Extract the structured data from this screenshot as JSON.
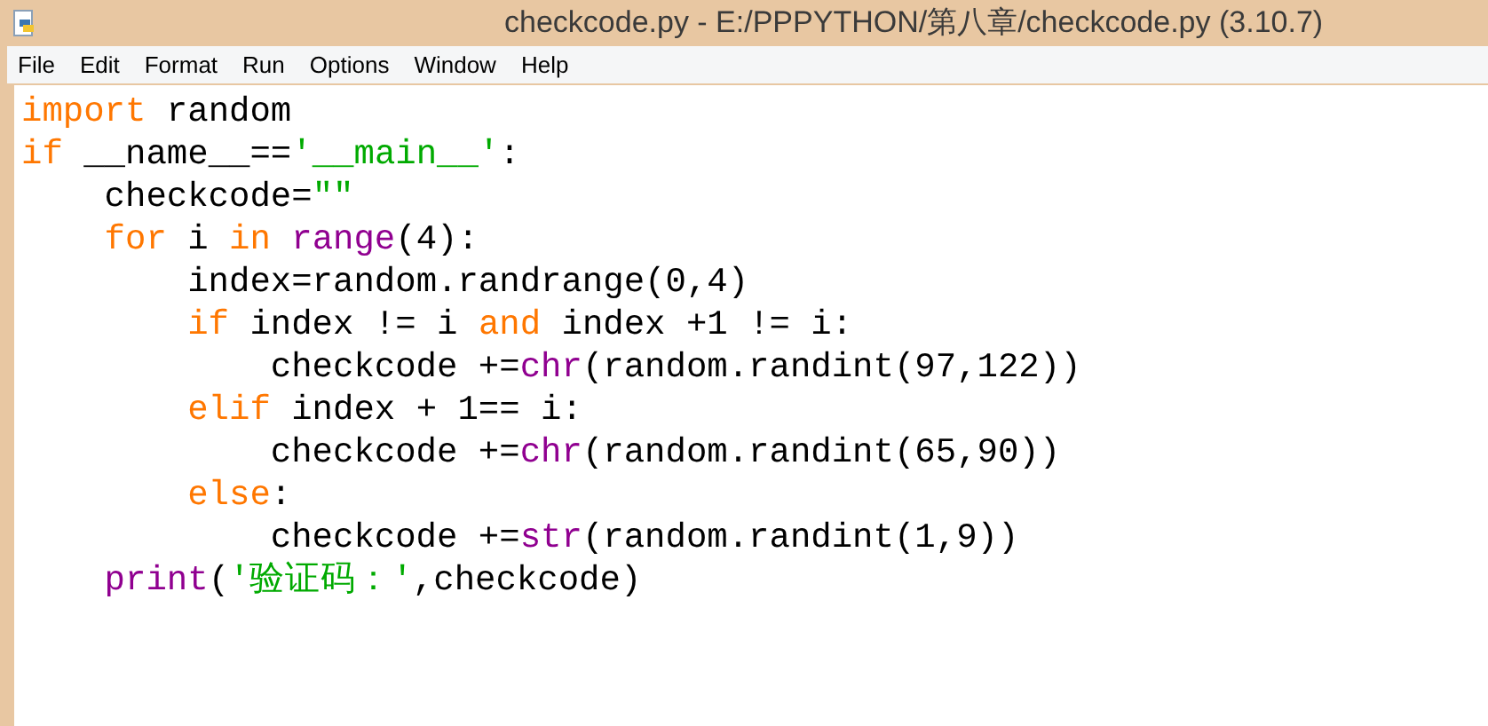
{
  "window": {
    "title": "checkcode.py - E:/PPPYTHON/第八章/checkcode.py (3.10.7)"
  },
  "menu": [
    "File",
    "Edit",
    "Format",
    "Run",
    "Options",
    "Window",
    "Help"
  ],
  "code_lines": [
    {
      "tokens": [
        {
          "kind": "keyword",
          "text": "import"
        },
        {
          "kind": "plain",
          "text": " random"
        }
      ]
    },
    {
      "tokens": [
        {
          "kind": "keyword",
          "text": "if"
        },
        {
          "kind": "plain",
          "text": " __name__=="
        },
        {
          "kind": "string",
          "text": "'__main__'"
        },
        {
          "kind": "plain",
          "text": ":"
        }
      ],
      "children": [
        {
          "tokens": [
            {
              "kind": "plain",
              "text": "checkcode="
            },
            {
              "kind": "string",
              "text": "\"\""
            }
          ]
        },
        {
          "tokens": [
            {
              "kind": "keyword",
              "text": "for"
            },
            {
              "kind": "plain",
              "text": " i "
            },
            {
              "kind": "keyword",
              "text": "in"
            },
            {
              "kind": "builtin",
              "text": " range"
            },
            {
              "kind": "plain",
              "text": "(4):"
            }
          ],
          "children": [
            {
              "tokens": [
                {
                  "kind": "plain",
                  "text": "index=random.randrange(0,4)"
                }
              ]
            },
            {
              "tokens": [
                {
                  "kind": "keyword",
                  "text": "if"
                },
                {
                  "kind": "plain",
                  "text": " index != i "
                },
                {
                  "kind": "keyword",
                  "text": "and"
                },
                {
                  "kind": "plain",
                  "text": " index +1 != i:"
                }
              ],
              "children": [
                {
                  "tokens": [
                    {
                      "kind": "plain",
                      "text": "checkcode +="
                    },
                    {
                      "kind": "builtin",
                      "text": "chr"
                    },
                    {
                      "kind": "plain",
                      "text": "(random.randint(97,122))"
                    }
                  ]
                }
              ]
            },
            {
              "tokens": [
                {
                  "kind": "keyword",
                  "text": "elif"
                },
                {
                  "kind": "plain",
                  "text": " index + 1== i:"
                }
              ],
              "children": [
                {
                  "tokens": [
                    {
                      "kind": "plain",
                      "text": "checkcode +="
                    },
                    {
                      "kind": "builtin",
                      "text": "chr"
                    },
                    {
                      "kind": "plain",
                      "text": "(random.randint(65,90))"
                    }
                  ]
                }
              ]
            },
            {
              "tokens": [
                {
                  "kind": "keyword",
                  "text": "else"
                },
                {
                  "kind": "plain",
                  "text": ":"
                }
              ],
              "children": [
                {
                  "tokens": [
                    {
                      "kind": "plain",
                      "text": "checkcode +="
                    },
                    {
                      "kind": "builtin",
                      "text": "str"
                    },
                    {
                      "kind": "plain",
                      "text": "(random.randint(1,9))"
                    }
                  ]
                }
              ]
            }
          ]
        },
        {
          "tokens": [
            {
              "kind": "builtin",
              "text": "print"
            },
            {
              "kind": "plain",
              "text": "("
            },
            {
              "kind": "string",
              "text": "'验证码：'"
            },
            {
              "kind": "plain",
              "text": ",checkcode)"
            }
          ]
        }
      ]
    }
  ]
}
